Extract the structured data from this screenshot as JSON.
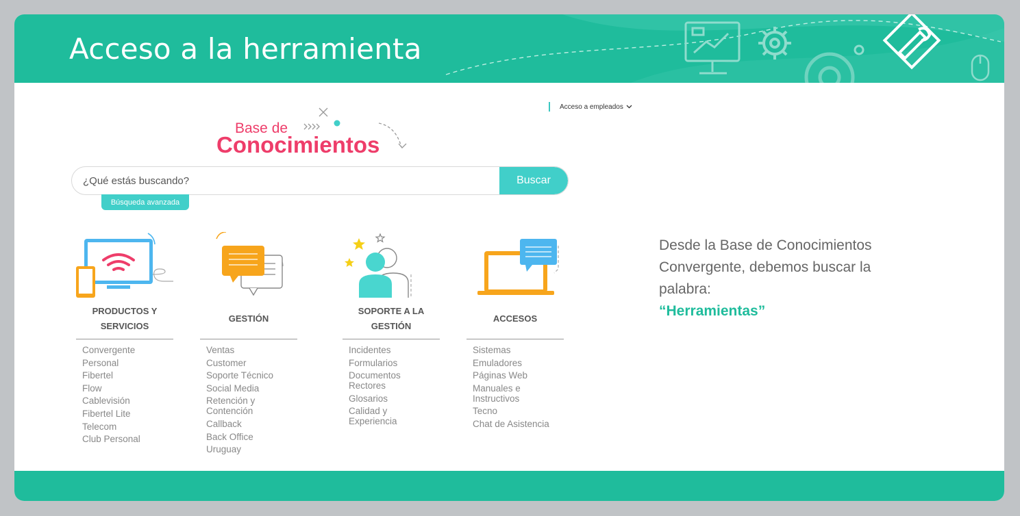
{
  "slide": {
    "title": "Acceso a la herramienta"
  },
  "page": {
    "employee_access": "Acceso a empleados",
    "logo_line1": "Base de",
    "logo_line2": "Conocimientos",
    "search": {
      "placeholder": "¿Qué estás buscando?",
      "button": "Buscar",
      "advanced": "Búsqueda avanzada"
    },
    "categories": [
      {
        "title": "PRODUCTOS Y SERVICIOS",
        "icon": "tv-wifi-icon",
        "items": [
          "Convergente",
          "Personal",
          "Fibertel",
          "Flow",
          "Cablevisión",
          "Fibertel Lite",
          "Telecom",
          "Club Personal"
        ]
      },
      {
        "title": "GESTIÓN",
        "icon": "chat-documents-icon",
        "items": [
          "Ventas",
          "Customer",
          "Soporte Técnico",
          "Social Media",
          "Retención y Contención",
          "Callback",
          "Back Office",
          "Uruguay"
        ]
      },
      {
        "title": "SOPORTE A LA GESTIÓN",
        "icon": "people-support-icon",
        "items": [
          "Incidentes",
          "Formularios",
          "Documentos Rectores",
          "Glosarios",
          "Calidad y Experiencia"
        ]
      },
      {
        "title": "ACCESOS",
        "icon": "laptop-chat-icon",
        "items": [
          "Sistemas",
          "Emuladores",
          "Páginas Web",
          "Manuales e Instructivos",
          "Tecno",
          "Chat de Asistencia"
        ]
      }
    ]
  },
  "note": {
    "text": "Desde la Base de Conocimientos Convergente, debemos buscar la palabra:",
    "highlight": "“Herramientas”"
  },
  "colors": {
    "teal": "#1fbc9c",
    "turquoise": "#41cfc9",
    "pink": "#ee3d6a",
    "orange": "#f7a51c",
    "blue": "#4db6ef"
  }
}
